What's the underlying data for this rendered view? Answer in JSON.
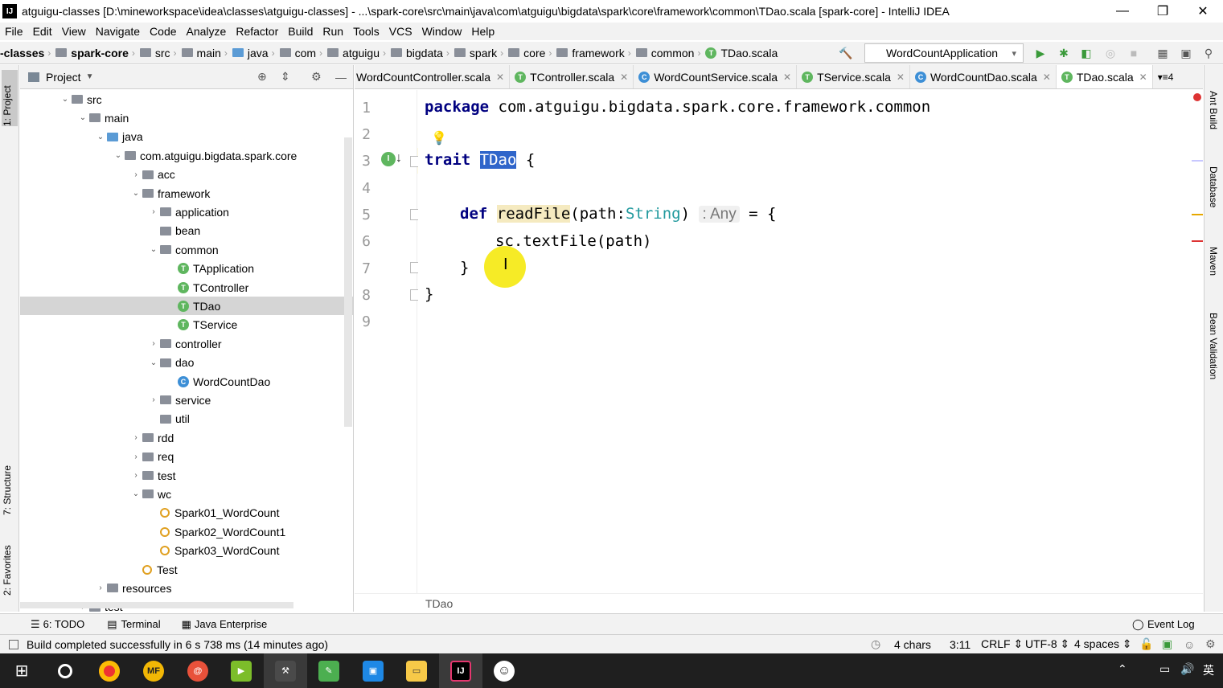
{
  "window": {
    "title": "atguigu-classes [D:\\mineworkspace\\idea\\classes\\atguigu-classes] - ...\\spark-core\\src\\main\\java\\com\\atguigu\\bigdata\\spark\\core\\framework\\common\\TDao.scala [spark-core] - IntelliJ IDEA",
    "logo": "IJ"
  },
  "menu": [
    "File",
    "Edit",
    "View",
    "Navigate",
    "Code",
    "Analyze",
    "Refactor",
    "Build",
    "Run",
    "Tools",
    "VCS",
    "Window",
    "Help"
  ],
  "navbar": {
    "crumbs": [
      "-classes",
      "spark-core",
      "src",
      "main",
      "java",
      "com",
      "atguigu",
      "bigdata",
      "spark",
      "core",
      "framework",
      "common",
      "TDao.scala"
    ],
    "run_config": "WordCountApplication"
  },
  "left_tabs": {
    "project": "1: Project",
    "structure": "7: Structure",
    "favorites": "2: Favorites"
  },
  "project_panel": {
    "title": "Project",
    "tree": [
      {
        "label": "src",
        "icon": "folder",
        "arrow": "down"
      },
      {
        "label": "main",
        "icon": "folder",
        "arrow": "down"
      },
      {
        "label": "java",
        "icon": "folder-blue",
        "arrow": "down"
      },
      {
        "label": "com.atguigu.bigdata.spark.core",
        "icon": "package",
        "arrow": "down"
      },
      {
        "label": "acc",
        "icon": "package",
        "arrow": "right"
      },
      {
        "label": "framework",
        "icon": "package",
        "arrow": "down"
      },
      {
        "label": "application",
        "icon": "package",
        "arrow": "right"
      },
      {
        "label": "bean",
        "icon": "package",
        "arrow": ""
      },
      {
        "label": "common",
        "icon": "package",
        "arrow": "down"
      },
      {
        "label": "TApplication",
        "icon": "trait",
        "arrow": ""
      },
      {
        "label": "TController",
        "icon": "trait",
        "arrow": ""
      },
      {
        "label": "TDao",
        "icon": "trait",
        "arrow": "",
        "selected": true
      },
      {
        "label": "TService",
        "icon": "trait",
        "arrow": ""
      },
      {
        "label": "controller",
        "icon": "package",
        "arrow": "right"
      },
      {
        "label": "dao",
        "icon": "package",
        "arrow": "down"
      },
      {
        "label": "WordCountDao",
        "icon": "class",
        "arrow": ""
      },
      {
        "label": "service",
        "icon": "package",
        "arrow": "right"
      },
      {
        "label": "util",
        "icon": "package",
        "arrow": ""
      },
      {
        "label": "rdd",
        "icon": "package",
        "arrow": "right"
      },
      {
        "label": "req",
        "icon": "package",
        "arrow": "right"
      },
      {
        "label": "test",
        "icon": "package",
        "arrow": "right"
      },
      {
        "label": "wc",
        "icon": "package",
        "arrow": "down"
      },
      {
        "label": "Spark01_WordCount",
        "icon": "object",
        "arrow": ""
      },
      {
        "label": "Spark02_WordCount1",
        "icon": "object",
        "arrow": ""
      },
      {
        "label": "Spark03_WordCount",
        "icon": "object",
        "arrow": ""
      },
      {
        "label": "Test",
        "icon": "object",
        "arrow": ""
      },
      {
        "label": "resources",
        "icon": "folder",
        "arrow": "right"
      },
      {
        "label": "test",
        "icon": "folder",
        "arrow": "right"
      }
    ]
  },
  "tabs": [
    {
      "label": "WordCountController.scala",
      "icon": "class"
    },
    {
      "label": "TController.scala",
      "icon": "trait"
    },
    {
      "label": "WordCountService.scala",
      "icon": "class"
    },
    {
      "label": "TService.scala",
      "icon": "trait"
    },
    {
      "label": "WordCountDao.scala",
      "icon": "class"
    },
    {
      "label": "TDao.scala",
      "icon": "trait",
      "active": true
    }
  ],
  "tabs_overflow": "4",
  "editor": {
    "line_numbers": [
      "1",
      "2",
      "3",
      "4",
      "5",
      "6",
      "7",
      "8",
      "9"
    ],
    "line1_kw": "package",
    "line1_rest": " com.atguigu.bigdata.spark.core.framework.common",
    "line3_kw": "trait",
    "line3_name": "TDao",
    "line3_rest": " {",
    "line5_kw": "def",
    "line5_fn": "readFile",
    "line5_p1": "(path:",
    "line5_type": "String",
    "line5_p2": ")",
    "line5_hint": ": Any",
    "line5_rest": " = {",
    "line6": "sc.textFile(path)",
    "line7": "}",
    "line8": "}",
    "bottom_crumb": "TDao"
  },
  "right_tabs": {
    "ant": "Ant Build",
    "db": "Database",
    "maven": "Maven",
    "bean": "Bean Validation"
  },
  "bottom_tools": {
    "todo": "6: TODO",
    "terminal": "Terminal",
    "java_ent": "Java Enterprise",
    "event_log": "Event Log"
  },
  "status": {
    "message": "Build completed successfully in 6 s 738 ms (14 minutes ago)",
    "chars": "4 chars",
    "position": "3:11",
    "line_sep": "CRLF",
    "encoding": "UTF-8",
    "indent": "4 spaces"
  },
  "taskbar": {
    "ime": "英"
  }
}
